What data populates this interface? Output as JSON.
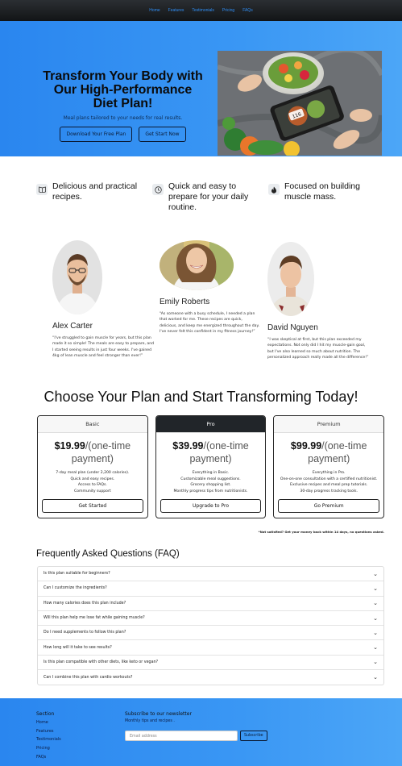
{
  "nav": {
    "items": [
      "Home",
      "Features",
      "Testimonials",
      "Pricing",
      "FAQs"
    ]
  },
  "hero": {
    "title": "Transform Your Body with Our High-Performance Diet Plan!",
    "subtitle": "Meal plans tailored to your needs for real results.",
    "primary_button": "Download Your Free Plan",
    "secondary_button": "Get Start Now",
    "phone_screen_text": "116"
  },
  "features": [
    {
      "icon": "book-icon",
      "text": "Delicious and practical recipes."
    },
    {
      "icon": "clock-icon",
      "text": "Quick and easy to prepare for your daily routine."
    },
    {
      "icon": "flame-icon",
      "text": "Focused on building muscle mass."
    }
  ],
  "testimonials": [
    {
      "name": "Alex Carter",
      "quote": "“I've struggled to gain muscle for years, but this plan made it so simple! The meals are easy to prepare, and I started seeing results in just four weeks. I've gained 4kg of lean muscle and feel stronger than ever!”"
    },
    {
      "name": "Emily Roberts",
      "quote": "“As someone with a busy schedule, I needed a plan that worked for me. These recipes are quick, delicious, and keep me energized throughout the day. I've never felt this confident in my fitness journey!”"
    },
    {
      "name": "David Nguyen",
      "quote": "“I was skeptical at first, but this plan exceeded my expectations. Not only did I hit my muscle-gain goal, but I've also learned so much about nutrition. The personalized approach really made all the difference!”"
    }
  ],
  "pricing": {
    "title": "Choose Your Plan and Start Transforming Today!",
    "plans": [
      {
        "name": "Basic",
        "price": "$19.99",
        "period": "/(one-time payment)",
        "features": [
          "7-day meal plan (under 2,200 calories).",
          "Quick and easy recipes.",
          "Access to FAQs.",
          "Community support"
        ],
        "button": "Get Started"
      },
      {
        "name": "Pro",
        "price": "$39.99",
        "period": "/(one-time payment)",
        "features": [
          "Everything in Basic.",
          "Customizable meal suggestions.",
          "Grocery shopping list.",
          "Monthly progress tips from nutritionists."
        ],
        "button": "Upgrade to Pro"
      },
      {
        "name": "Premium",
        "price": "$99.99",
        "period": "/(one-time payment)",
        "features": [
          "Everything in Pro.",
          "One-on-one consultation with a certified nutritionist.",
          "Exclusive recipes and meal prep tutorials.",
          "30-day progress tracking tools."
        ],
        "button": "Go Premium"
      }
    ],
    "guarantee": "*Not satisfied? Get your money back within 14 days, no questions asked."
  },
  "faq": {
    "title": "Frequently Asked Questions (FAQ)",
    "items": [
      "Is this plan suitable for beginners?",
      "Can I customize the ingredients?",
      "How many calories does this plan include?",
      "Will this plan help me lose fat while gaining muscle?",
      "Do I need supplements to follow this plan?",
      "How long will it take to see results?",
      "Is this plan compatible with other diets, like keto or vegan?",
      "Can I combine this plan with cardio workouts?"
    ]
  },
  "footer": {
    "section_title": "Section",
    "links": [
      "Home",
      "Features",
      "Testimonials",
      "Pricing",
      "FAQs"
    ],
    "newsletter_title": "Subscribe to our newsletter",
    "newsletter_desc": "Monthly tips and recipes .",
    "email_placeholder": "Email address",
    "subscribe_button": "Subscribe"
  }
}
